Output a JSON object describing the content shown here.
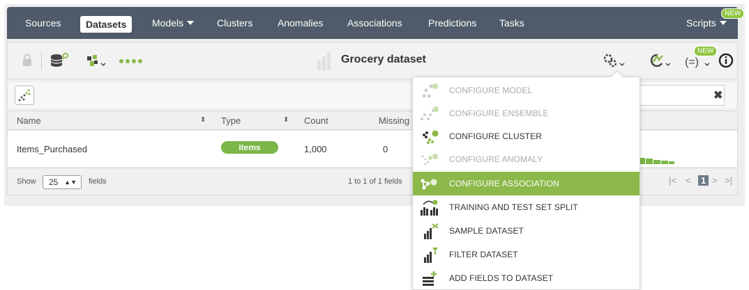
{
  "nav": {
    "items": [
      {
        "label": "Sources"
      },
      {
        "label": "Datasets"
      },
      {
        "label": "Models"
      },
      {
        "label": "Clusters"
      },
      {
        "label": "Anomalies"
      },
      {
        "label": "Associations"
      },
      {
        "label": "Predictions"
      },
      {
        "label": "Tasks"
      }
    ],
    "scripts_label": "Scripts",
    "new_badge": "NEW"
  },
  "toolbar": {
    "title": "Grocery dataset",
    "new_badge": "NEW"
  },
  "table": {
    "headers": [
      "Name",
      "Type",
      "Count",
      "Missing"
    ],
    "rows": [
      {
        "name": "Items_Purchased",
        "type": "items",
        "count": "1,000",
        "missing": "0"
      }
    ]
  },
  "footer": {
    "show_label": "Show",
    "show_value": "25",
    "fields_label": "fields",
    "range_text": "1 to 1 of 1 fields",
    "current_page": "1"
  },
  "dropdown": {
    "items": [
      {
        "label": "CONFIGURE MODEL",
        "state": "disabled"
      },
      {
        "label": "CONFIGURE ENSEMBLE",
        "state": "disabled"
      },
      {
        "label": "CONFIGURE CLUSTER",
        "state": "enabled"
      },
      {
        "label": "CONFIGURE ANOMALY",
        "state": "disabled"
      },
      {
        "label": "CONFIGURE ASSOCIATION",
        "state": "hover"
      },
      {
        "label": "TRAINING AND TEST SET SPLIT",
        "state": "enabled"
      },
      {
        "label": "SAMPLE DATASET",
        "state": "enabled"
      },
      {
        "label": "FILTER DATASET",
        "state": "enabled"
      },
      {
        "label": "ADD FIELDS TO DATASET",
        "state": "enabled"
      }
    ]
  },
  "colors": {
    "nav_bg": "#4f5b6a",
    "accent_green": "#8cb94a",
    "badge_green": "#7ab648"
  },
  "icons": {
    "lock": "lock-icon",
    "database": "database-search-icon",
    "model": "model-config-icon",
    "more": "more-dots-icon",
    "settings": "gears-icon",
    "batch": "batch-prediction-icon",
    "formula": "formula-icon",
    "info": "info-icon"
  }
}
